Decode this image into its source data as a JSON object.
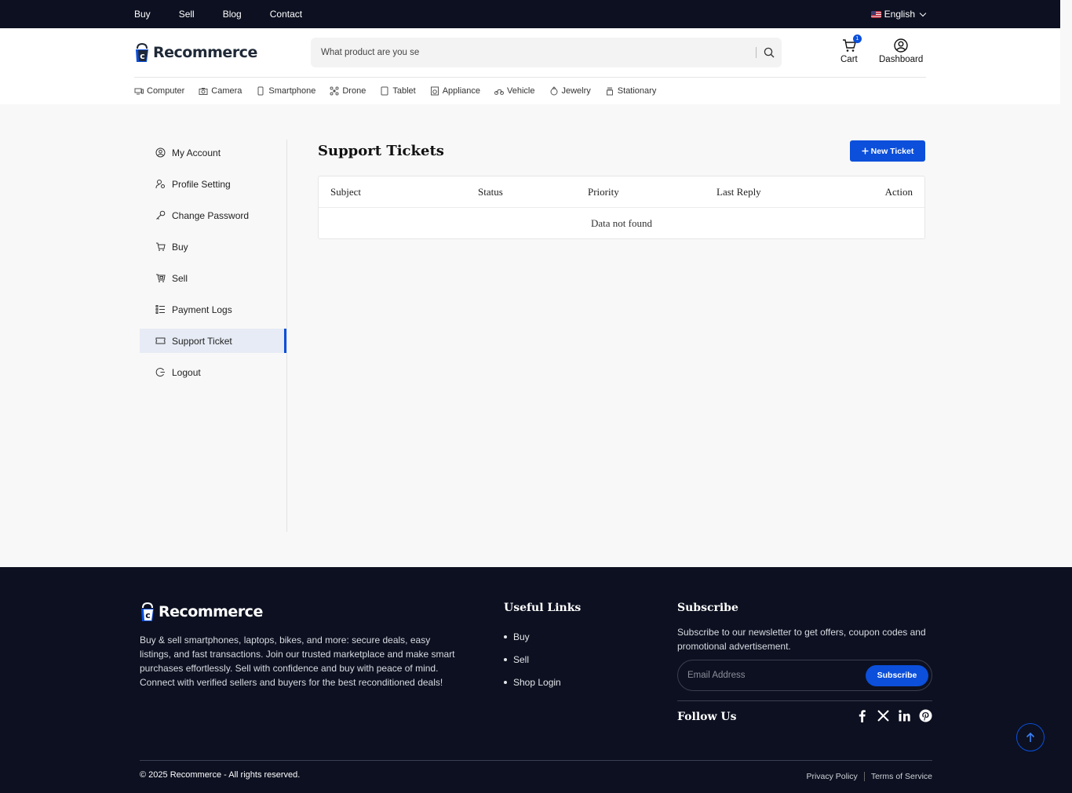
{
  "topbar": {
    "links": [
      "Buy",
      "Sell",
      "Blog",
      "Contact"
    ],
    "language": "English"
  },
  "header": {
    "brand": "Recommerce",
    "search_placeholder": "What product are you se",
    "cart_label": "Cart",
    "cart_count": "1",
    "dashboard_label": "Dashboard"
  },
  "categories": [
    {
      "label": "Computer",
      "icon": "computer-icon"
    },
    {
      "label": "Camera",
      "icon": "camera-icon"
    },
    {
      "label": "Smartphone",
      "icon": "smartphone-icon"
    },
    {
      "label": "Drone",
      "icon": "drone-icon"
    },
    {
      "label": "Tablet",
      "icon": "tablet-icon"
    },
    {
      "label": "Appliance",
      "icon": "appliance-icon"
    },
    {
      "label": "Vehicle",
      "icon": "vehicle-icon"
    },
    {
      "label": "Jewelry",
      "icon": "jewelry-icon"
    },
    {
      "label": "Stationary",
      "icon": "stationary-icon"
    }
  ],
  "sidebar": {
    "items": [
      {
        "label": "My Account",
        "icon": "user-circle-icon"
      },
      {
        "label": "Profile Setting",
        "icon": "user-gear-icon"
      },
      {
        "label": "Change Password",
        "icon": "key-icon"
      },
      {
        "label": "Buy",
        "icon": "cart-icon"
      },
      {
        "label": "Sell",
        "icon": "sell-cart-icon"
      },
      {
        "label": "Payment Logs",
        "icon": "list-icon"
      },
      {
        "label": "Support Ticket",
        "icon": "ticket-icon"
      },
      {
        "label": "Logout",
        "icon": "logout-icon"
      }
    ],
    "active": "Support Ticket"
  },
  "main": {
    "title": "Support Tickets",
    "new_ticket_label": "New Ticket",
    "columns": [
      "Subject",
      "Status",
      "Priority",
      "Last Reply",
      "Action"
    ],
    "empty_text": "Data not found"
  },
  "footer": {
    "brand": "Recommerce",
    "description": "Buy & sell smartphones, laptops, bikes, and more: secure deals, easy listings, and fast transactions. Join our trusted marketplace and make smart purchases effortlessly. Sell with confidence and buy with peace of mind. Connect with verified sellers and buyers for the best reconditioned deals!",
    "useful_links_title": "Useful Links",
    "useful_links": [
      "Buy",
      "Sell",
      "Shop Login"
    ],
    "subscribe_title": "Subscribe",
    "subscribe_text": "Subscribe to our newsletter to get offers, coupon codes and promotional advertisement.",
    "email_placeholder": "Email Address",
    "subscribe_button": "Subscribe",
    "follow_title": "Follow Us",
    "socials": [
      "facebook-icon",
      "x-icon",
      "linkedin-icon",
      "pinterest-icon"
    ],
    "copyright": "© 2025 Recommerce - All rights reserved.",
    "privacy": "Privacy Policy",
    "terms": "Terms of Service"
  },
  "colors": {
    "accent": "#0b4fdb",
    "dark": "#0c1020"
  }
}
